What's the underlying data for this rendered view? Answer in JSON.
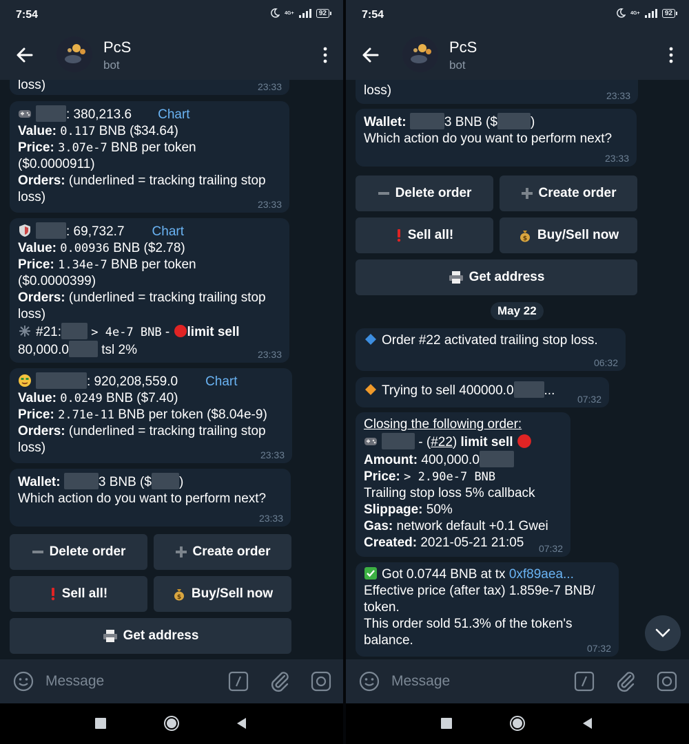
{
  "status": {
    "time": "7:54",
    "network": "4G+",
    "battery": "92"
  },
  "chat": {
    "title": "PcS",
    "subtitle": "bot"
  },
  "input": {
    "placeholder": "Message"
  },
  "left": {
    "m0": {
      "text": "loss)",
      "time": "23:33"
    },
    "m1": {
      "amount": ": 380,213.6",
      "chart": "Chart",
      "value_label": "Value:",
      "value_mono": "0.117",
      "value_rest": " BNB ($34.64)",
      "price_label": "Price:",
      "price_mono": "3.07e-7",
      "price_rest": " BNB per token",
      "price_usd": "($0.0000911)",
      "orders_label": "Orders:",
      "orders_rest": " (underlined = tracking trailing stop",
      "orders_end": "loss)",
      "time": "23:33"
    },
    "m2": {
      "amount": ": 69,732.7",
      "chart": "Chart",
      "value_label": "Value:",
      "value_mono": "0.00936",
      "value_rest": " BNB ($2.78)",
      "price_label": "Price:",
      "price_mono": "1.34e-7",
      "price_rest": " BNB per token",
      "price_usd": "($0.0000399)",
      "orders_label": "Orders:",
      "orders_rest": " (underlined = tracking trailing stop",
      "orders_end": "loss)",
      "order_id": "#21:",
      "order_mono": "> 4e-7 BNB",
      "order_dash": " - ",
      "order_type": "limit sell",
      "order_amt": "80,000.0",
      "order_tsl": "tsl 2%",
      "time": "23:33"
    },
    "m3": {
      "amount": ": 920,208,559.0",
      "chart": "Chart",
      "value_label": "Value:",
      "value_mono": "0.0249",
      "value_rest": " BNB ($7.40)",
      "price_label": "Price:",
      "price_mono": "2.71e-11",
      "price_rest": " BNB per token ($8.04e-9)",
      "orders_label": "Orders:",
      "orders_rest": " (underlined = tracking trailing stop",
      "orders_end": "loss)",
      "time": "23:33"
    },
    "m4": {
      "wallet_label": "Wallet:",
      "wallet_mid": "3 BNB ($",
      "wallet_end": ")",
      "question": "Which action do you want to perform next?",
      "time": "23:33"
    }
  },
  "right": {
    "m0": {
      "text": "loss)",
      "time": "23:33"
    },
    "m1": {
      "wallet_label": "Wallet:",
      "wallet_mid": "3 BNB ($",
      "wallet_end": ")",
      "question": "Which action do you want to perform next?",
      "time": "23:33"
    },
    "date": "May 22",
    "m2": {
      "text": "Order #22 activated trailing stop loss.",
      "time": "06:32"
    },
    "m3": {
      "text": "Trying to sell 400000.0",
      "ellipsis": "...",
      "time": "07:32"
    },
    "m4": {
      "heading": "Closing the following order:",
      "dash": " - (",
      "ref": "#22",
      "close": ") ",
      "type": "limit sell",
      "amount_label": "Amount:",
      "amount": " 400,000.0",
      "price_label": "Price:",
      "price_mono": "> 2.90e-7 BNB",
      "trailing": "Trailing stop loss 5% callback",
      "slip_label": "Slippage:",
      "slip": " 50%",
      "gas_label": "Gas:",
      "gas": " network default +0.1 Gwei",
      "created_label": "Created:",
      "created": " 2021-05-21 21:05",
      "time": "07:32"
    },
    "m5": {
      "got": "Got 0.0744 BNB at tx ",
      "tx": "0xf89aea...",
      "eff1": "Effective price (after tax) 1.859e-7 BNB/",
      "eff2": "token.",
      "sold1": "This order sold 51.3% of the token's",
      "sold2": "balance.",
      "time": "07:32"
    }
  },
  "keyboard": {
    "delete": "Delete order",
    "create": "Create order",
    "sell_all": "Sell all!",
    "buy_sell": "Buy/Sell now",
    "address": "Get address"
  },
  "icons": [
    "back-arrow-icon",
    "more-vert-icon",
    "moon-icon",
    "signal-icon",
    "battery-icon",
    "minus-icon",
    "plus-icon",
    "exclamation-icon",
    "money-bag-icon",
    "printer-icon",
    "emoji-icon",
    "command-icon",
    "attach-icon",
    "camera-icon",
    "square-nav-icon",
    "home-nav-icon",
    "back-nav-icon",
    "chevron-down-icon",
    "game-controller-icon",
    "shield-icon",
    "money-face-icon",
    "red-circle-icon",
    "blue-diamond-icon",
    "orange-diamond-icon",
    "check-mark-icon",
    "sparkle-icon"
  ],
  "colors": {
    "header": "#1d2733",
    "background": "#111a22",
    "bubble": "#182533",
    "button": "#25313e",
    "link": "#6ab3f3",
    "time": "#6d8094"
  }
}
